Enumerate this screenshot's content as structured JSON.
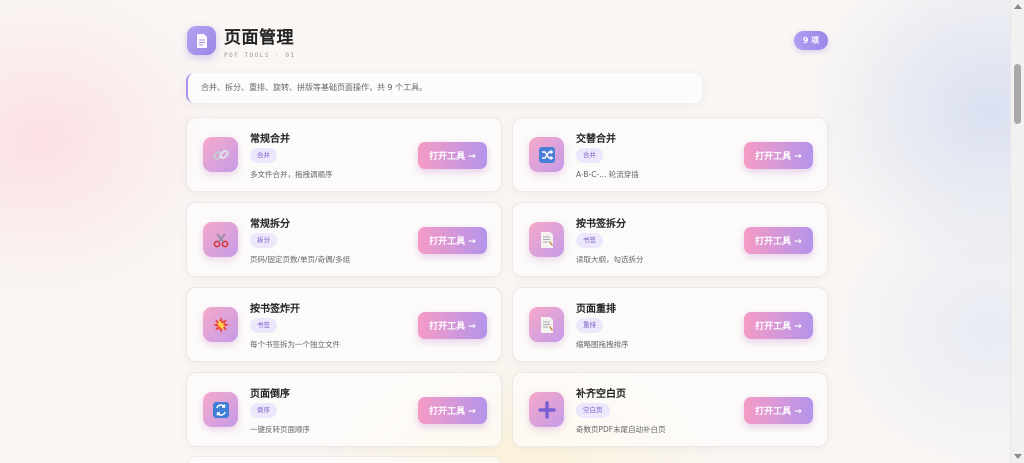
{
  "header": {
    "title": "页面管理",
    "subtitle": "PDF TOOLS · 01",
    "count_badge": "9 项",
    "logo_icon": "document-icon"
  },
  "description": "合并、拆分、重排、旋转、拼版等基础页面操作，共 9 个工具。",
  "tools": [
    {
      "name": "常规合并",
      "tag": "合并",
      "desc": "多文件合并，拖拽调顺序",
      "icon": "link-icon",
      "button": "打开工具 →"
    },
    {
      "name": "交替合并",
      "tag": "合并",
      "desc": "A-B-C-... 轮流穿插",
      "icon": "shuffle-icon",
      "button": "打开工具 →"
    },
    {
      "name": "常规拆分",
      "tag": "拆分",
      "desc": "页码/固定页数/单页/奇偶/多组",
      "icon": "scissors-icon",
      "button": "打开工具 →"
    },
    {
      "name": "按书签拆分",
      "tag": "书签",
      "desc": "读取大纲，勾选拆分",
      "icon": "bookmark-doc-icon",
      "button": "打开工具 →"
    },
    {
      "name": "按书签炸开",
      "tag": "书签",
      "desc": "每个书签拆为一个独立文件",
      "icon": "explosion-icon",
      "button": "打开工具 →"
    },
    {
      "name": "页面重排",
      "tag": "重排",
      "desc": "缩略图拖拽排序",
      "icon": "reorder-doc-icon",
      "button": "打开工具 →"
    },
    {
      "name": "页面倒序",
      "tag": "倒序",
      "desc": "一键反转页面顺序",
      "icon": "reverse-icon",
      "button": "打开工具 →"
    },
    {
      "name": "补齐空白页",
      "tag": "空白页",
      "desc": "奇数页PDF末尾自动补白页",
      "icon": "plus-icon",
      "button": "打开工具 →"
    }
  ],
  "colors": {
    "accent": "#9b87e8",
    "button_start": "#f59bc5",
    "button_end": "#b494ea",
    "tag_bg": "#ede7fb"
  }
}
